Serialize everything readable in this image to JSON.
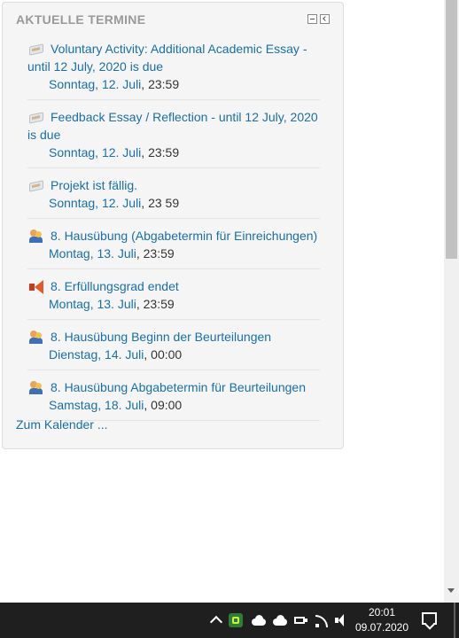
{
  "block": {
    "title": "AKTUELLE TERMINE",
    "calendar_link": "Zum Kalender ..."
  },
  "events": [
    {
      "icon": "assignment-icon",
      "title": "Voluntary Activity: Additional Academic Essay - until 12 July, 2020 is due",
      "date": "Sonntag, 12. Juli",
      "time": ", 23:59"
    },
    {
      "icon": "assignment-icon",
      "title": "Feedback Essay / Reflection - until 12 July, 2020 is due",
      "date": "Sonntag, 12. Juli",
      "time": ", 23:59"
    },
    {
      "icon": "assignment-icon",
      "title": "Projekt ist fällig.",
      "date": "Sonntag, 12. Juli",
      "time": ", 23 59"
    },
    {
      "icon": "workshop-icon",
      "title": "8. Hausübung (Abgabetermin für Einreichungen)",
      "date": "Montag, 13. Juli",
      "time": ", 23:59"
    },
    {
      "icon": "announcement-icon",
      "title": "8. Erfüllungsgrad endet",
      "date": "Montag, 13. Juli",
      "time": ", 23:59"
    },
    {
      "icon": "workshop-icon",
      "title": "8. Hausübung Beginn der Beurteilungen",
      "date": "Dienstag, 14. Juli",
      "time": ", 00:00"
    },
    {
      "icon": "workshop-icon",
      "title": "8. Hausübung Abgabetermin für Beurteilungen",
      "date": "Samstag, 18. Juli",
      "time": ", 09:00"
    }
  ],
  "taskbar": {
    "time": "20:01",
    "date": "09.07.2020"
  },
  "colors": {
    "link": "#1a6fa8",
    "block_bg": "#f5f5f5",
    "taskbar": "#1f1f1f"
  }
}
